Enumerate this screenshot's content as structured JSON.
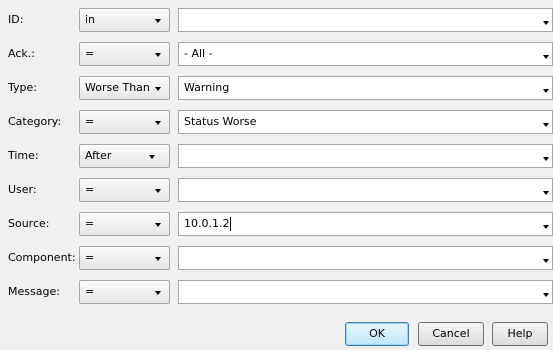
{
  "filters": [
    {
      "key": "id",
      "label": "ID:",
      "operator": "in",
      "value": ""
    },
    {
      "key": "ack",
      "label": "Ack.:",
      "operator": "=",
      "value": "- All -"
    },
    {
      "key": "type",
      "label": "Type:",
      "operator": "Worse Than",
      "value": "Warning"
    },
    {
      "key": "category",
      "label": "Category:",
      "operator": "=",
      "value": "Status Worse"
    },
    {
      "key": "time",
      "label": "Time:",
      "operator": "After",
      "value": ""
    },
    {
      "key": "user",
      "label": "User:",
      "operator": "=",
      "value": ""
    },
    {
      "key": "source",
      "label": "Source:",
      "operator": "=",
      "value": "10.0.1.2"
    },
    {
      "key": "component",
      "label": "Component:",
      "operator": "=",
      "value": ""
    },
    {
      "key": "message",
      "label": "Message:",
      "operator": "=",
      "value": ""
    }
  ],
  "buttons": {
    "ok": "OK",
    "cancel": "Cancel",
    "help": "Help"
  },
  "icons": {
    "dropdown": "chevron-down-icon"
  }
}
